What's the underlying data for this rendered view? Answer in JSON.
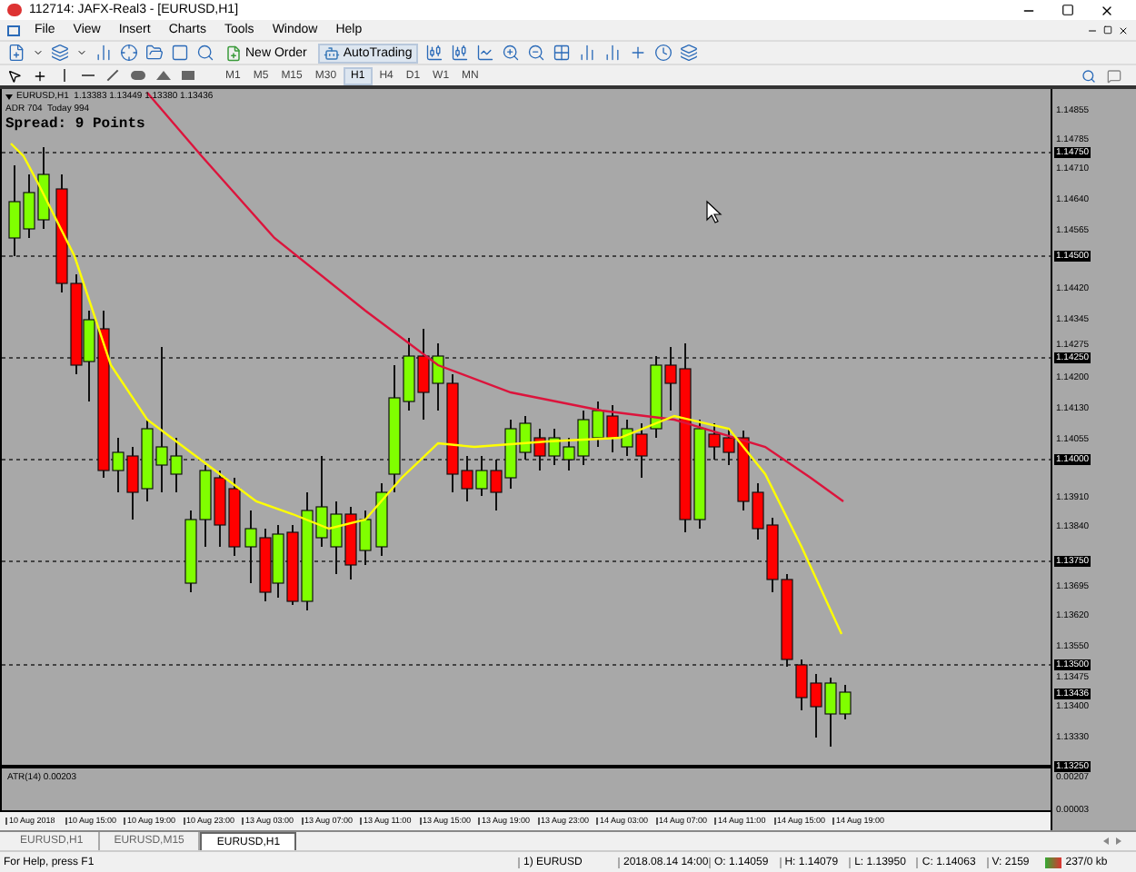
{
  "window": {
    "title": "112714: JAFX-Real3 - [EURUSD,H1]"
  },
  "menu": [
    "File",
    "View",
    "Insert",
    "Charts",
    "Tools",
    "Window",
    "Help"
  ],
  "toolbar": {
    "buttons": [
      {
        "kind": "new_order",
        "label": "New Order"
      },
      {
        "kind": "autotrading",
        "label": "AutoTrading"
      }
    ],
    "timeframes": [
      {
        "label": "M1",
        "selected": false
      },
      {
        "label": "M5",
        "selected": false
      },
      {
        "label": "M15",
        "selected": false
      },
      {
        "label": "M30",
        "selected": false
      },
      {
        "label": "H1",
        "selected": true
      },
      {
        "label": "H4",
        "selected": false
      },
      {
        "label": "D1",
        "selected": false
      },
      {
        "label": "W1",
        "selected": false
      },
      {
        "label": "MN",
        "selected": false
      }
    ]
  },
  "chart": {
    "header": "EURUSD,H1  1.13383 1.13449 1.13380 1.13436",
    "adr": "ADR 704  Today 994",
    "spread": "Spread: 9 Points",
    "price_axis": [
      {
        "label": "1.14855",
        "kind": "tick"
      },
      {
        "label": "1.14785",
        "kind": "tick"
      },
      {
        "label": "1.14750",
        "kind": "marker"
      },
      {
        "label": "1.14710",
        "kind": "tick"
      },
      {
        "label": "1.14640",
        "kind": "tick"
      },
      {
        "label": "1.14565",
        "kind": "tick"
      },
      {
        "label": "1.14500",
        "kind": "marker"
      },
      {
        "label": "1.14420",
        "kind": "tick"
      },
      {
        "label": "1.14345",
        "kind": "tick"
      },
      {
        "label": "1.14275",
        "kind": "tick"
      },
      {
        "label": "1.14250",
        "kind": "marker"
      },
      {
        "label": "1.14200",
        "kind": "tick"
      },
      {
        "label": "1.14130",
        "kind": "tick"
      },
      {
        "label": "1.14055",
        "kind": "tick"
      },
      {
        "label": "1.14000",
        "kind": "marker"
      },
      {
        "label": "1.13910",
        "kind": "tick"
      },
      {
        "label": "1.13840",
        "kind": "tick"
      },
      {
        "label": "1.13750",
        "kind": "marker"
      },
      {
        "label": "1.13695",
        "kind": "tick"
      },
      {
        "label": "1.13620",
        "kind": "tick"
      },
      {
        "label": "1.13550",
        "kind": "tick"
      },
      {
        "label": "1.13500",
        "kind": "marker"
      },
      {
        "label": "1.13475",
        "kind": "tick"
      },
      {
        "label": "1.13436",
        "kind": "marker"
      },
      {
        "label": "1.13400",
        "kind": "tick"
      },
      {
        "label": "1.13330",
        "kind": "tick"
      },
      {
        "label": "1.13250",
        "kind": "marker"
      }
    ],
    "indicator": {
      "label": "ATR(14) 0.00203",
      "axis": [
        "0.00207",
        "0.00003"
      ]
    },
    "time_axis": [
      "10 Aug 2018",
      "10 Aug 15:00",
      "10 Aug 19:00",
      "10 Aug 23:00",
      "13 Aug 03:00",
      "13 Aug 07:00",
      "13 Aug 11:00",
      "13 Aug 15:00",
      "13 Aug 19:00",
      "13 Aug 23:00",
      "14 Aug 03:00",
      "14 Aug 07:00",
      "14 Aug 11:00",
      "14 Aug 15:00",
      "14 Aug 19:00"
    ]
  },
  "tabs": [
    {
      "label": "EURUSD,H1",
      "selected": false
    },
    {
      "label": "EURUSD,M15",
      "selected": false
    },
    {
      "label": "EURUSD,H1",
      "selected": true
    }
  ],
  "status_bar": {
    "help": "For Help, press F1",
    "profile": "1) EURUSD",
    "fields": [
      "2018.08.14 14:00",
      "O: 1.14059",
      "H: 1.14079",
      "L: 1.13950",
      "C: 1.14063",
      "V: 2159"
    ],
    "traffic": "237/0 kb"
  }
}
